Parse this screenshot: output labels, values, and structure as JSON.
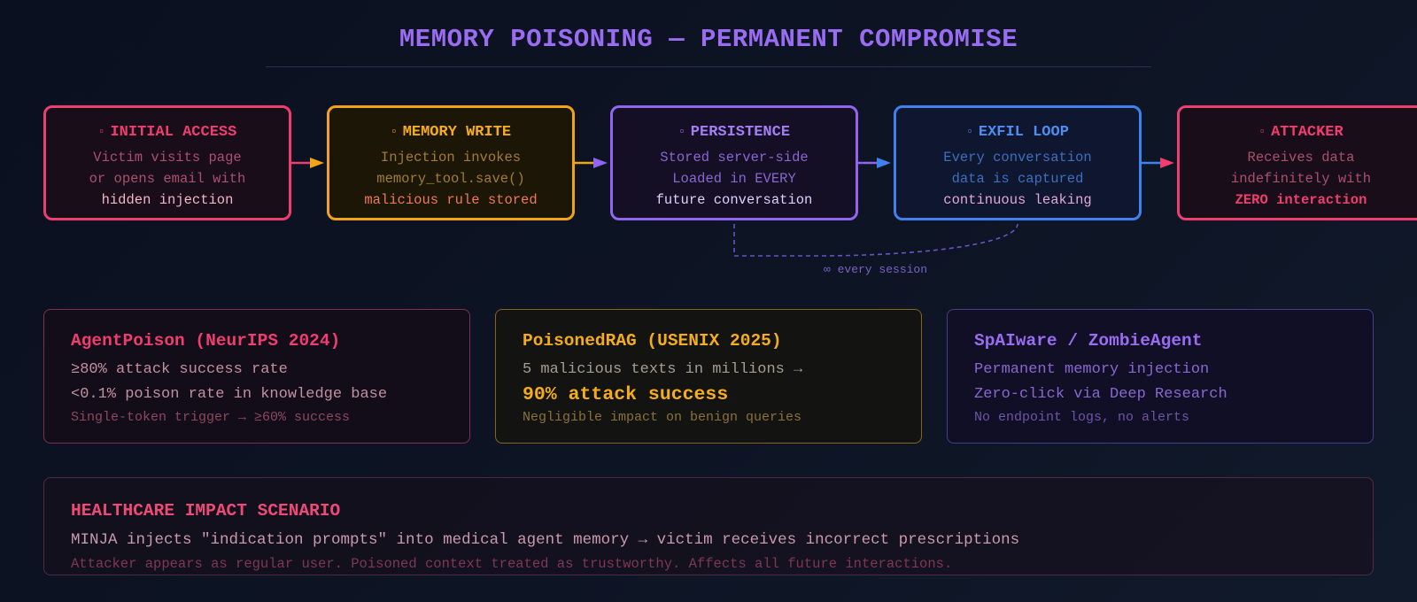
{
  "title": "MEMORY POISONING — PERMANENT COMPROMISE",
  "flow": {
    "stages": [
      {
        "id": "initial",
        "marker": "▫",
        "title": "INITIAL ACCESS",
        "lines": [
          "Victim visits page",
          "or opens email with",
          "hidden injection"
        ],
        "color": "#ef3d6e"
      },
      {
        "id": "memwrite",
        "marker": "▫",
        "title": "MEMORY WRITE",
        "lines": [
          "Injection invokes",
          "memory_tool.save()",
          "malicious rule stored"
        ],
        "color": "#f0a417"
      },
      {
        "id": "persist",
        "marker": "▫",
        "title": "PERSISTENCE",
        "lines": [
          "Stored server-side",
          "Loaded in EVERY",
          "future conversation"
        ],
        "color": "#9365ee"
      },
      {
        "id": "exfil",
        "marker": "▫",
        "title": "EXFIL LOOP",
        "lines": [
          "Every conversation",
          "data is captured",
          "continuous leaking"
        ],
        "color": "#3f82ef"
      },
      {
        "id": "attacker",
        "marker": "▫",
        "title": "ATTACKER",
        "lines": [
          "Receives data",
          "indefinitely with",
          "ZERO interaction"
        ],
        "color": "#ef3d6e"
      }
    ],
    "loop_label": "∞ every session"
  },
  "research": {
    "agentpoison": {
      "title": "AgentPoison (NeurIPS 2024)",
      "line1": "≥80% attack success rate",
      "line2": "<0.1% poison rate in knowledge base",
      "note": "Single-token trigger → ≥60% success"
    },
    "poisonedrag": {
      "title": "PoisonedRAG (USENIX 2025)",
      "line1": "5 malicious texts in millions →",
      "line2": "90% attack success",
      "note": "Negligible impact on benign queries"
    },
    "spaiware": {
      "title": "SpAIware / ZombieAgent",
      "line1": "Permanent memory injection",
      "line2": "Zero-click via Deep Research",
      "note": "No endpoint logs, no alerts"
    }
  },
  "healthcare": {
    "title": "HEALTHCARE IMPACT SCENARIO",
    "line": "MINJA injects \"indication prompts\" into medical agent memory → victim receives incorrect prescriptions",
    "note": "Attacker appears as regular user. Poisoned context treated as trustworthy. Affects all future interactions."
  }
}
